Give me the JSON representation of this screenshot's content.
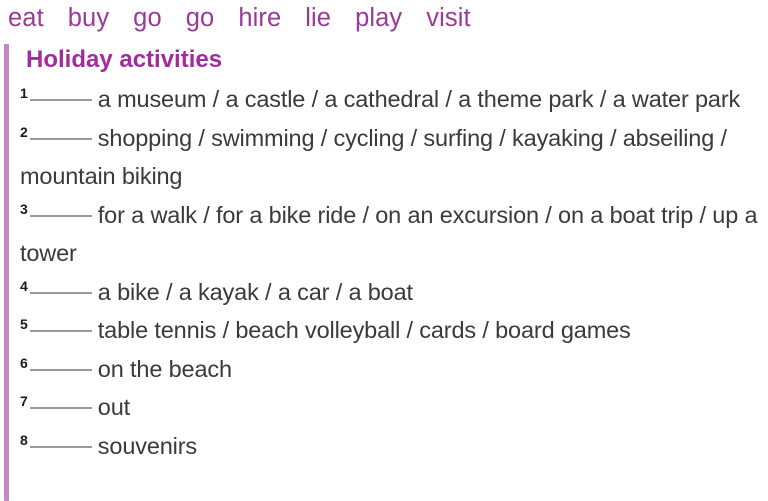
{
  "word_bank": {
    "words": [
      "eat",
      "buy",
      "go",
      "go",
      "hire",
      "lie",
      "play",
      "visit"
    ]
  },
  "heading": {
    "title": "Holiday activities"
  },
  "exercises": [
    {
      "number": "1",
      "text": "a museum / a castle / a cathedral / a theme park / a water park"
    },
    {
      "number": "2",
      "text": "shopping / swimming / cycling / surfing / kayaking / abseiling / mountain biking"
    },
    {
      "number": "3",
      "text": "for a walk / for a bike ride / on an excursion / on a boat trip / up a tower"
    },
    {
      "number": "4",
      "text": "a bike / a kayak / a car / a boat"
    },
    {
      "number": "5",
      "text": "table tennis / beach volleyball / cards / board games"
    },
    {
      "number": "6",
      "text": "on the beach"
    },
    {
      "number": "7",
      "text": "out"
    },
    {
      "number": "8",
      "text": "souvenirs"
    }
  ],
  "colors": {
    "word_bank_purple": "#9B3A96",
    "heading_purple": "#A32BA0",
    "accent_bar_purple": "#C089C6",
    "body_text": "#3a3a3a",
    "blank_line": "#9a9a9a",
    "background": "#ffffff"
  }
}
